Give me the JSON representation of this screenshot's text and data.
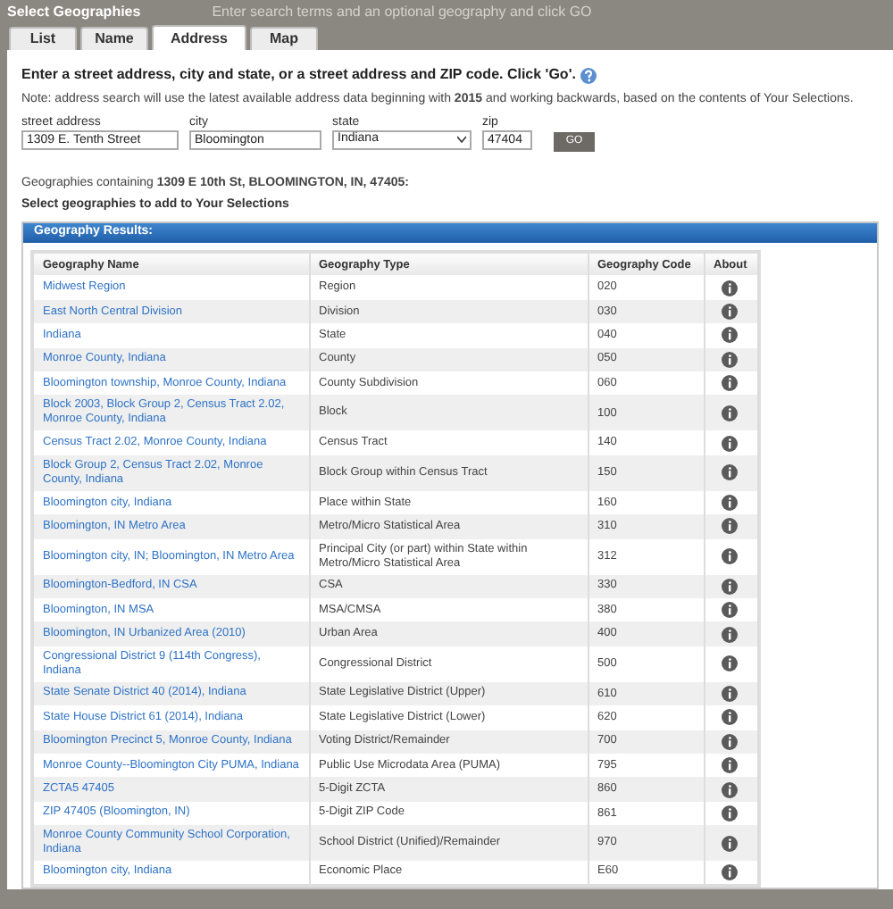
{
  "background_hint": "Enter search terms and an optional geography and click GO",
  "dialog": {
    "title": "Select Geographies"
  },
  "tabs": [
    {
      "label": "List",
      "selected": false
    },
    {
      "label": "Name",
      "selected": false
    },
    {
      "label": "Address",
      "selected": true
    },
    {
      "label": "Map",
      "selected": false
    }
  ],
  "instructions": "Enter a street address, city and state, or a street address and ZIP code. Click 'Go'.",
  "note": "Note: address search will use the latest available address data beginning with **2015** and working backwards, based on the contents of Your Selections.",
  "fields": [
    {
      "label": "street address",
      "value": "1309 E. Tenth Street",
      "kind": "text"
    },
    {
      "label": "city",
      "value": "Bloomington",
      "kind": "text"
    },
    {
      "label": "state",
      "value": "Indiana",
      "kind": "select"
    },
    {
      "label": "zip",
      "value": "47404",
      "kind": "text"
    }
  ],
  "go_button": "GO",
  "result_caption": "Geographies containing **1309 E 10th St, BLOOMINGTON, IN, 47405:**",
  "select_prompt": "Select geographies to add to Your Selections",
  "results": {
    "title": "Geography Results:",
    "columns": [
      "Geography Name",
      "Geography Type",
      "Geography Code",
      "About"
    ],
    "rows": [
      {
        "name": "Midwest Region",
        "type": "Region",
        "code": "020"
      },
      {
        "name": "East North Central Division",
        "type": "Division",
        "code": "030"
      },
      {
        "name": "Indiana",
        "type": "State",
        "code": "040"
      },
      {
        "name": "Monroe County, Indiana",
        "type": "County",
        "code": "050"
      },
      {
        "name": "Bloomington township, Monroe County, Indiana",
        "type": "County Subdivision",
        "code": "060"
      },
      {
        "name": "Block 2003, Block Group 2, Census Tract 2.02, Monroe County, Indiana",
        "type": "Block",
        "code": "100"
      },
      {
        "name": "Census Tract 2.02, Monroe County, Indiana",
        "type": "Census Tract",
        "code": "140"
      },
      {
        "name": "Block Group 2, Census Tract 2.02, Monroe County, Indiana",
        "type": "Block Group within Census Tract",
        "code": "150"
      },
      {
        "name": "Bloomington city, Indiana",
        "type": "Place within State",
        "code": "160"
      },
      {
        "name": "Bloomington, IN Metro Area",
        "type": "Metro/Micro Statistical Area",
        "code": "310"
      },
      {
        "name": "Bloomington city, IN; Bloomington, IN Metro Area",
        "type": "Principal City (or part) within State within Metro/Micro Statistical Area",
        "code": "312"
      },
      {
        "name": "Bloomington-Bedford, IN CSA",
        "type": "CSA",
        "code": "330"
      },
      {
        "name": "Bloomington, IN MSA",
        "type": "MSA/CMSA",
        "code": "380"
      },
      {
        "name": "Bloomington, IN Urbanized Area (2010)",
        "type": "Urban Area",
        "code": "400"
      },
      {
        "name": "Congressional District 9 (114th Congress), Indiana",
        "type": "Congressional District",
        "code": "500"
      },
      {
        "name": "State Senate District 40 (2014), Indiana",
        "type": "State Legislative District (Upper)",
        "code": "610"
      },
      {
        "name": "State House District 61 (2014), Indiana",
        "type": "State Legislative District (Lower)",
        "code": "620"
      },
      {
        "name": "Bloomington Precinct 5, Monroe County, Indiana",
        "type": "Voting District/Remainder",
        "code": "700"
      },
      {
        "name": "Monroe County--Bloomington City PUMA, Indiana",
        "type": "Public Use Microdata Area (PUMA)",
        "code": "795"
      },
      {
        "name": "ZCTA5 47405",
        "type": "5-Digit ZCTA",
        "code": "860"
      },
      {
        "name": "ZIP 47405 (Bloomington, IN)",
        "type": "5-Digit ZIP Code",
        "code": "861"
      },
      {
        "name": "Monroe County Community School Corporation, Indiana",
        "type": "School District (Unified)/Remainder",
        "code": "970"
      },
      {
        "name": "Bloomington city, Indiana",
        "type": "Economic Place",
        "code": "E60"
      }
    ]
  }
}
